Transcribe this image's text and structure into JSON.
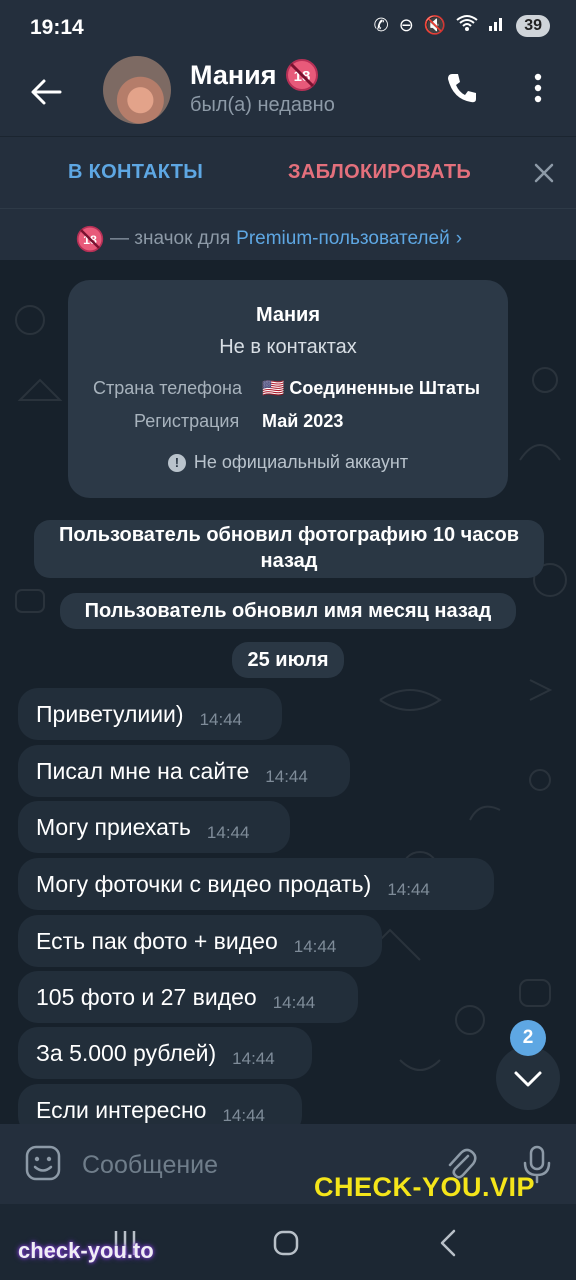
{
  "status_bar": {
    "time": "19:14",
    "battery": "39"
  },
  "header": {
    "title": "Мания",
    "subtitle": "был(а) недавно"
  },
  "action_bar": {
    "add_contact": "В КОНТАКТЫ",
    "block": "ЗАБЛОКИРОВАТЬ"
  },
  "premium_notice": {
    "text": "— значок для",
    "link": "Premium-пользователей",
    "chevron": "›"
  },
  "info_card": {
    "name": "Мания",
    "status": "Не в контактах",
    "phone_country_label": "Страна телефона",
    "phone_country_value": "🇺🇸 Соединенные Штаты",
    "registration_label": "Регистрация",
    "registration_value": "Май 2023",
    "note": "Не официальный аккаунт"
  },
  "service_messages": [
    "Пользователь обновил фотографию 10 часов назад",
    "Пользователь обновил имя месяц назад",
    "25 июля"
  ],
  "messages": [
    {
      "text": "Приветулиии)",
      "time": "14:44"
    },
    {
      "text": "Писал мне на сайте",
      "time": "14:44"
    },
    {
      "text": "Могу приехать",
      "time": "14:44"
    },
    {
      "text": "Могу фоточки с видео продать)",
      "time": "14:44"
    },
    {
      "text": "Есть пак фото + видео",
      "time": "14:44"
    },
    {
      "text": "105 фото и 27 видео",
      "time": "14:44"
    },
    {
      "text": "За 5.000 рублей)",
      "time": "14:44"
    },
    {
      "text": "Если интересно",
      "time": "14:44"
    }
  ],
  "unread_badge": "2",
  "input": {
    "placeholder": "Сообщение"
  },
  "watermarks": {
    "yellow": "CHECK-YOU.VIP",
    "bottom": "check-you.to"
  },
  "colors": {
    "accent": "#5ea7e3",
    "danger": "#e4707c",
    "bg": "#17212b",
    "bubble": "#222e3a"
  },
  "icons": [
    "back-arrow-icon",
    "call-icon",
    "more-vert-icon",
    "close-icon",
    "premium-18-icon",
    "info-icon",
    "chevron-down-icon",
    "emoji-icon",
    "attach-icon",
    "mic-icon",
    "nav-recents-icon",
    "nav-home-icon",
    "nav-back-icon"
  ]
}
